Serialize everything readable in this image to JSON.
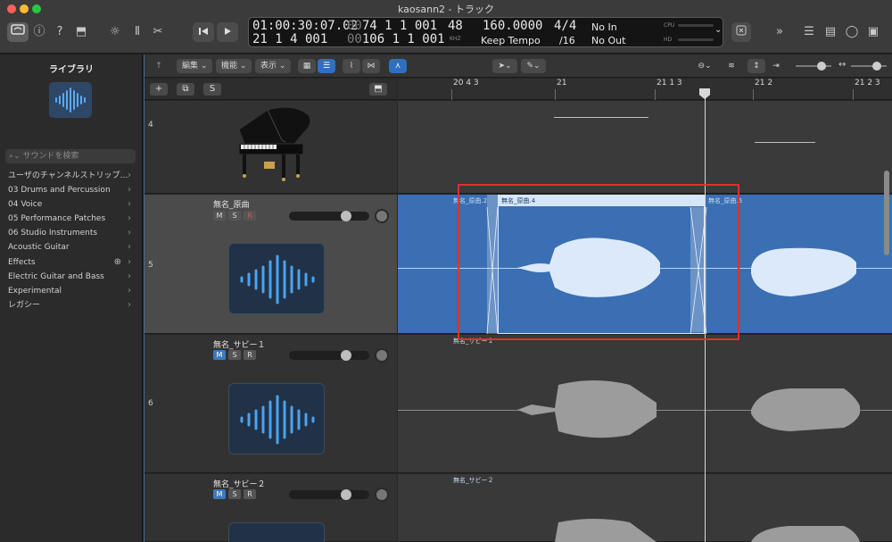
{
  "window": {
    "title": "kaosann2 - トラック"
  },
  "lcd": {
    "smpte": "01:00:30:07.02",
    "smpte_dim": "00:00:00:00",
    "bars_pos": "21  1  4  001",
    "bars_dim": "00:00:00:00",
    "bars_end_dim": "00",
    "bars_end": "74  1  1  001",
    "bars_end2_dim": "00",
    "bars_end2": "106  1  1  001",
    "sample_rate": "48",
    "sample_rate_unit": "KHZ",
    "tempo": "160.0000",
    "tempo_mode": "Keep Tempo",
    "time_sig": "4/4",
    "division": "/16",
    "midi_in": "No In",
    "midi_out": "No Out",
    "cpu_label": "CPU",
    "hd_label": "HD"
  },
  "library": {
    "title": "ライブラリ",
    "search_placeholder": "サウンドを検索",
    "items": [
      {
        "label": "ユーザのチャンネルストリップ…"
      },
      {
        "label": "03 Drums and Percussion"
      },
      {
        "label": "04 Voice"
      },
      {
        "label": "05 Performance Patches"
      },
      {
        "label": "06 Studio Instruments"
      },
      {
        "label": "Acoustic Guitar"
      },
      {
        "label": "Effects"
      },
      {
        "label": "Electric Guitar and Bass"
      },
      {
        "label": "Experimental"
      },
      {
        "label": "レガシー"
      }
    ]
  },
  "toolbar": {
    "edit": "編集",
    "functions": "機能",
    "view": "表示"
  },
  "track_header_bar": {
    "add": "+",
    "duplicate": "⧉",
    "s": "S"
  },
  "ruler": {
    "labels": [
      "20 4 3",
      "21",
      "21 1 3",
      "21 2",
      "21 2 3"
    ]
  },
  "tracks": [
    {
      "number": "4",
      "name": ""
    },
    {
      "number": "5",
      "name": "無名_原曲",
      "m": "M",
      "s": "S",
      "r": "R"
    },
    {
      "number": "6",
      "name": "無名_サビー１",
      "m": "M",
      "s": "S",
      "r": "R"
    },
    {
      "number": "",
      "name": "無名_サビー２",
      "m": "M",
      "s": "S",
      "r": "R"
    }
  ],
  "regions": {
    "track5_a": "無名_原曲.2",
    "track5_b": "無名_原曲.4",
    "track5_c": "無名_原曲.5",
    "track6": "無名_サビー１",
    "track7": "無名_サビー２"
  },
  "colors": {
    "accent": "#3b7bbd",
    "region_blue": "#3a6fb3",
    "highlight": "#e03030"
  }
}
